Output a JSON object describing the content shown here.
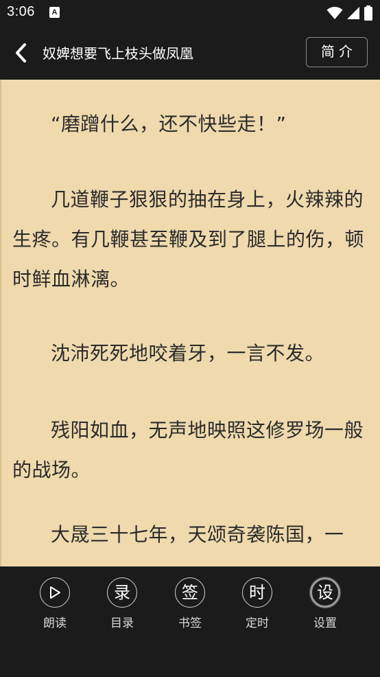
{
  "status_bar": {
    "time": "3:06",
    "notification_icon_letter": "A",
    "icons": [
      "wifi-icon",
      "signal-icon",
      "battery-icon"
    ]
  },
  "app_bar": {
    "title": "奴婢想要飞上枝头做凤凰",
    "intro_label": "简介"
  },
  "content": {
    "paragraphs": [
      "“磨蹭什么，还不快些走！”",
      "几道鞭子狠狠的抽在身上，火辣辣的生疼。有几鞭甚至鞭及到了腿上的伤，顿时鲜血淋漓。",
      "沈沛死死地咬着牙，一言不发。",
      "残阳如血，无声地映照这修罗场一般的战场。",
      "大晟三十七年，天颂奇袭陈国，一"
    ]
  },
  "toolbar": {
    "items": [
      {
        "glyph": "▷",
        "label": "朗读"
      },
      {
        "glyph": "录",
        "label": "目录"
      },
      {
        "glyph": "签",
        "label": "书签"
      },
      {
        "glyph": "时",
        "label": "定时"
      },
      {
        "glyph": "设",
        "label": "设置"
      }
    ]
  },
  "colors": {
    "bar_background": "#1b1b1b",
    "reader_background": "#efd9ad",
    "reader_text": "#2b2b2b"
  }
}
